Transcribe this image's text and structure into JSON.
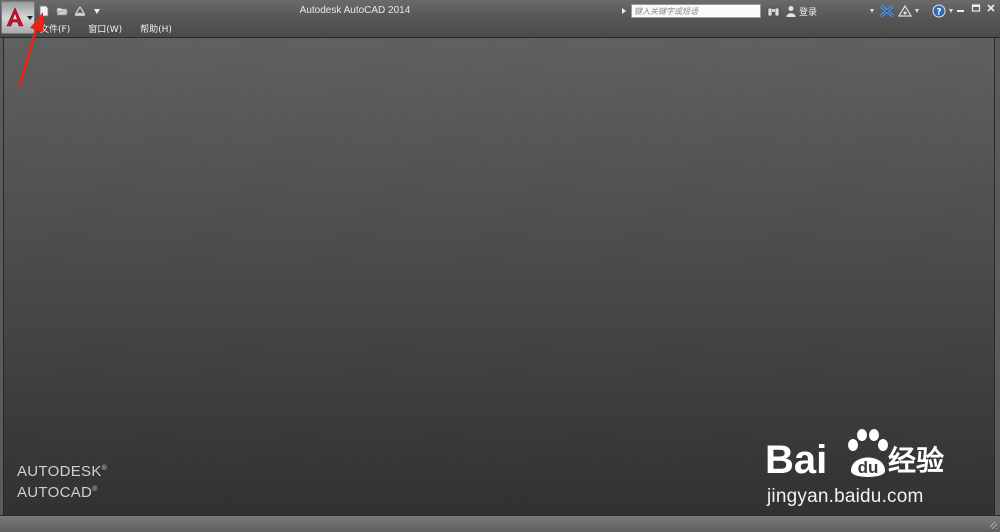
{
  "window": {
    "title": "Autodesk AutoCAD 2014"
  },
  "quick_access": {
    "items": [
      {
        "name": "new-file",
        "icon": "new-file-icon"
      },
      {
        "name": "open-file",
        "icon": "open-folder-icon"
      },
      {
        "name": "plot",
        "icon": "plot-icon"
      }
    ],
    "dropdown_icon": "chevron-down-icon"
  },
  "menu": {
    "items": [
      {
        "label": "文件(F)"
      },
      {
        "label": "窗口(W)"
      },
      {
        "label": "帮助(H)"
      }
    ]
  },
  "infocenter": {
    "search_placeholder": "键入关键字或短语",
    "login_label": "登录"
  },
  "brand": {
    "line1": "AUTODESK",
    "line2": "AUTOCAD",
    "reg": "®"
  },
  "watermark": {
    "logo_text": "Bai",
    "logo_du": "du",
    "logo_suffix": "经验",
    "url": "jingyan.baidu.com"
  },
  "colors": {
    "accent_red": "#c8102e",
    "annotation_red": "#e8231a",
    "canvas_top": "#5e5e5e",
    "canvas_bottom": "#2f2f2f"
  }
}
